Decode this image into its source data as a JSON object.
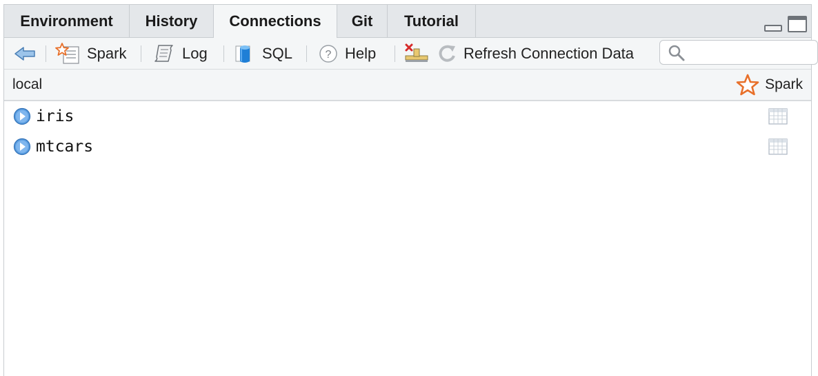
{
  "tabs": [
    {
      "label": "Environment"
    },
    {
      "label": "History"
    },
    {
      "label": "Connections"
    },
    {
      "label": "Git"
    },
    {
      "label": "Tutorial"
    }
  ],
  "toolbar": {
    "spark_label": "Spark",
    "log_label": "Log",
    "sql_label": "SQL",
    "help_label": "Help",
    "refresh_label": "Refresh Connection Data",
    "search_placeholder": "",
    "search_value": ""
  },
  "connection": {
    "name": "local",
    "type_label": "Spark"
  },
  "tree": {
    "items": [
      {
        "name": "iris"
      },
      {
        "name": "mtcars"
      }
    ]
  },
  "colors": {
    "spark_orange": "#e8702a",
    "expand_blue": "#4a90d9",
    "sql_blue": "#1f7fd6",
    "tab_bg": "#e4e7ea",
    "toolbar_bg": "#f4f6f7"
  }
}
